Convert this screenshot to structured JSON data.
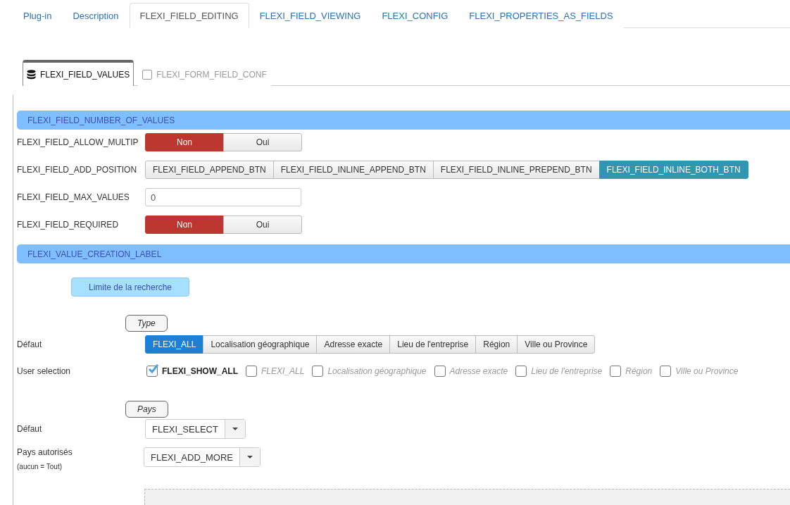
{
  "tabs": [
    {
      "label": "Plug-in",
      "selected": false
    },
    {
      "label": "Description",
      "selected": false
    },
    {
      "label": "FLEXI_FIELD_EDITING",
      "selected": true
    },
    {
      "label": "FLEXI_FIELD_VIEWING",
      "selected": false
    },
    {
      "label": "FLEXI_CONFIG",
      "selected": false
    },
    {
      "label": "FLEXI_PROPERTIES_AS_FIELDS",
      "selected": false
    }
  ],
  "subtabs": [
    {
      "label": "FLEXI_FIELD_VALUES",
      "kind": "database",
      "selected": true
    },
    {
      "label": "FLEXI_FORM_FIELD_CONF",
      "kind": "square",
      "selected": false
    }
  ],
  "sections": [
    {
      "title": "FLEXI_FIELD_NUMBER_OF_VALUES",
      "fields": [
        {
          "kind": "toggle",
          "label": "FLEXI_FIELD_ALLOW_MULTIP",
          "options": [
            {
              "label": "Non",
              "selected": true
            },
            {
              "label": "Oui",
              "selected": false
            }
          ]
        },
        {
          "kind": "button_group",
          "label": "FLEXI_FIELD_ADD_POSITION",
          "options": [
            {
              "label": "FLEXI_FIELD_APPEND_BTN",
              "selected": false
            },
            {
              "label": "FLEXI_FIELD_INLINE_APPEND_BTN",
              "selected": false
            },
            {
              "label": "FLEXI_FIELD_INLINE_PREPEND_BTN",
              "selected": false
            },
            {
              "label": "FLEXI_FIELD_INLINE_BOTH_BTN",
              "selected": true
            }
          ]
        },
        {
          "kind": "text",
          "label": "FLEXI_FIELD_MAX_VALUES",
          "value": "0"
        },
        {
          "kind": "toggle",
          "label": "FLEXI_FIELD_REQUIRED",
          "options": [
            {
              "label": "Non",
              "selected": true
            },
            {
              "label": "Oui",
              "selected": false
            }
          ]
        }
      ]
    },
    {
      "title": "FLEXI_VALUE_CREATION_LABEL",
      "button": "Limite de la recherche",
      "groups": [
        {
          "legend": "Type",
          "fields": [
            {
              "kind": "filter_group",
              "label": "Défaut",
              "options": [
                {
                  "label": "FLEXI_ALL",
                  "selected": true
                },
                {
                  "label": "Localisation géographique",
                  "selected": false
                },
                {
                  "label": "Adresse exacte",
                  "selected": false
                },
                {
                  "label": "Lieu de l'entreprise",
                  "selected": false
                },
                {
                  "label": "Région",
                  "selected": false
                },
                {
                  "label": "Ville ou Province",
                  "selected": false
                }
              ]
            },
            {
              "kind": "checkboxes",
              "label": "User selection",
              "options": [
                {
                  "label": "FLEXI_SHOW_ALL",
                  "checked": true
                },
                {
                  "label": "FLEXI_ALL",
                  "checked": false
                },
                {
                  "label": "Localisation géographique",
                  "checked": false
                },
                {
                  "label": "Adresse exacte",
                  "checked": false
                },
                {
                  "label": "Lieu de l'entreprise",
                  "checked": false
                },
                {
                  "label": "Région",
                  "checked": false
                },
                {
                  "label": "Ville ou Province",
                  "checked": false
                }
              ]
            }
          ]
        },
        {
          "legend": "Pays",
          "fields": [
            {
              "kind": "select",
              "label": "Défaut",
              "value": "FLEXI_SELECT"
            },
            {
              "kind": "select",
              "label": "Pays autorisés",
              "note": "(aucun = Tout)",
              "value": "FLEXI_ADD_MORE"
            }
          ]
        }
      ]
    }
  ]
}
